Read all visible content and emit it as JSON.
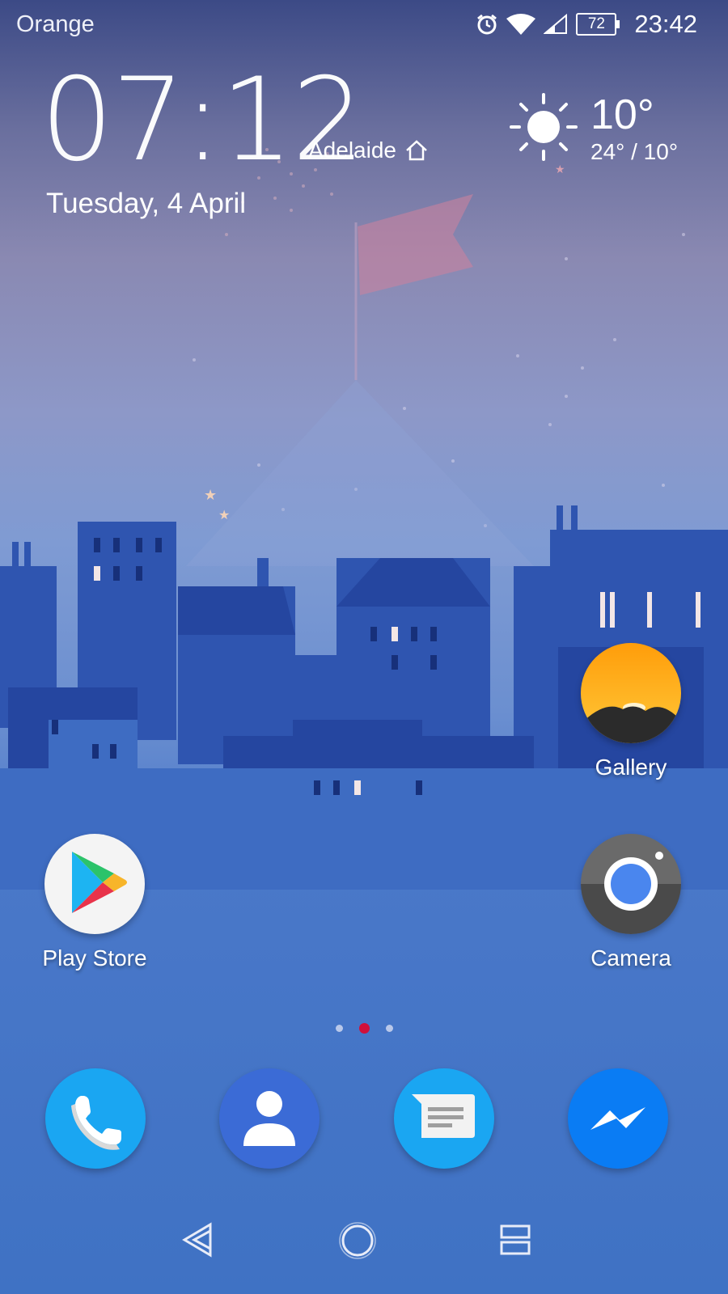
{
  "status_bar": {
    "carrier": "Orange",
    "battery_level": "72",
    "time": "23:42",
    "icons": [
      "alarm-icon",
      "wifi-icon",
      "signal-icon",
      "battery-icon"
    ]
  },
  "clock_widget": {
    "time": "07:12",
    "city": "Adelaide",
    "date": "Tuesday, 4 April"
  },
  "weather_widget": {
    "icon": "sun-icon",
    "temperature": "10°",
    "range": "24° / 10°"
  },
  "apps": [
    {
      "label": "Gallery",
      "icon": "gallery-icon"
    },
    {
      "label": "Play Store",
      "icon": "play-store-icon"
    },
    {
      "label": "Camera",
      "icon": "camera-icon"
    }
  ],
  "page_indicator": {
    "pages": 3,
    "current": 2
  },
  "dock": [
    {
      "icon": "phone-icon",
      "color": "#1aa6f2"
    },
    {
      "icon": "contacts-icon",
      "color": "#3b6bd6"
    },
    {
      "icon": "messages-icon",
      "color": "#1aa6f2"
    },
    {
      "icon": "messenger-icon",
      "color": "#0a7cf4"
    }
  ],
  "nav_bar": [
    "back-icon",
    "home-icon",
    "recents-icon"
  ]
}
